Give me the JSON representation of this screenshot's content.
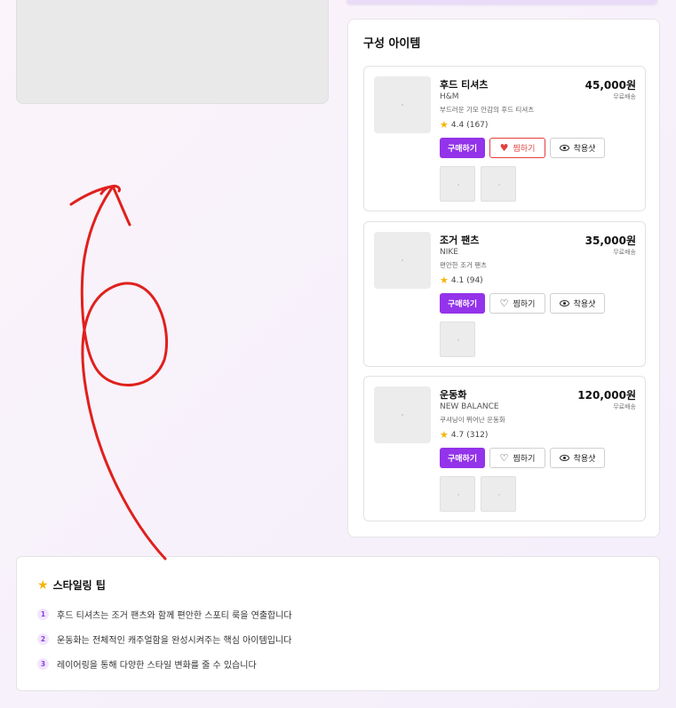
{
  "panel": {
    "title": "구성 아이템"
  },
  "items": [
    {
      "name": "후드 티셔츠",
      "brand": "H&M",
      "description": "부드러운 기모 안감의 후드 티셔츠",
      "price": "45,000원",
      "shipping": "무료배송",
      "rating": "4.4",
      "reviews": "(167)",
      "buy_label": "구매하기",
      "wish_label": "찜하기",
      "wished": true,
      "try_label": "착용샷",
      "sub_images": 2
    },
    {
      "name": "조거 팬츠",
      "brand": "NIKE",
      "description": "편안한 조거 팬츠",
      "price": "35,000원",
      "shipping": "무료배송",
      "rating": "4.1",
      "reviews": "(94)",
      "buy_label": "구매하기",
      "wish_label": "찜하기",
      "wished": false,
      "try_label": "착용샷",
      "sub_images": 1
    },
    {
      "name": "운동화",
      "brand": "NEW BALANCE",
      "description": "쿠셔닝이 뛰어난 운동화",
      "price": "120,000원",
      "shipping": "무료배송",
      "rating": "4.7",
      "reviews": "(312)",
      "buy_label": "구매하기",
      "wish_label": "찜하기",
      "wished": false,
      "try_label": "착용샷",
      "sub_images": 2
    }
  ],
  "tips": {
    "title": "스타일링 팁",
    "items": [
      {
        "num": "1",
        "text": "후드 티셔츠는 조거 팬츠와 함께 편안한 스포티 룩을 연출합니다"
      },
      {
        "num": "2",
        "text": "운동화는 전체적인 캐주얼함을 완성시켜주는 핵심 아이템입니다"
      },
      {
        "num": "3",
        "text": "레이어링을 통해 다양한 스타일 변화를 줄 수 있습니다"
      }
    ]
  },
  "colors": {
    "accent": "#9333ea",
    "wish_active": "#e53e3e",
    "star": "#f5b50a",
    "annotation": "#e0201c"
  },
  "icons": [
    "star-icon",
    "heart-icon",
    "eye-icon",
    "sparkle-star-icon"
  ]
}
